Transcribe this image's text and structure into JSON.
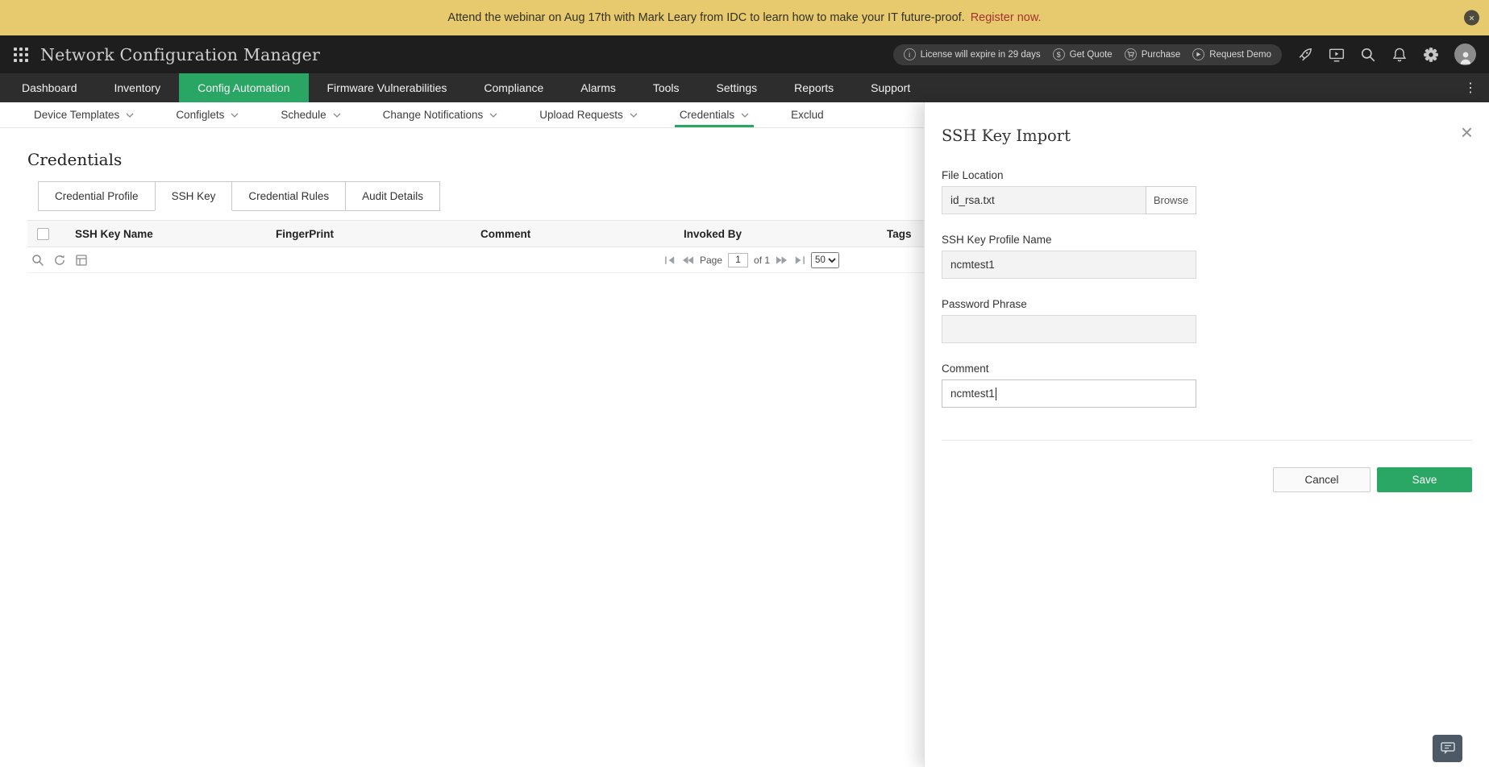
{
  "colors": {
    "accent_green": "#2aa664",
    "banner_bg": "#e8ca6e",
    "banner_link_red": "#a33432",
    "header_bg": "#1e1e1e",
    "nav_bg": "#2d2d2d",
    "save_button_green": "#2aa765"
  },
  "icons": {
    "close_glyph": "×",
    "overflow_glyph": "⋮",
    "info_glyph": "i",
    "dollar_glyph": "$"
  },
  "banner": {
    "text": "Attend the webinar on Aug 17th with Mark Leary from IDC to learn how to make your IT future-proof.",
    "link": "Register now."
  },
  "header": {
    "title": "Network Configuration Manager",
    "license_badge": "License will expire in 29 days",
    "quick_links": [
      {
        "label": "Get Quote"
      },
      {
        "label": "Purchase"
      },
      {
        "label": "Request Demo"
      }
    ]
  },
  "nav": {
    "active": "Config Automation",
    "items": [
      {
        "label": "Dashboard"
      },
      {
        "label": "Inventory"
      },
      {
        "label": "Config Automation"
      },
      {
        "label": "Firmware Vulnerabilities"
      },
      {
        "label": "Compliance"
      },
      {
        "label": "Alarms"
      },
      {
        "label": "Tools"
      },
      {
        "label": "Settings"
      },
      {
        "label": "Reports"
      },
      {
        "label": "Support"
      }
    ]
  },
  "subnav": {
    "active": "Credentials",
    "items": [
      {
        "label": "Device Templates"
      },
      {
        "label": "Configlets"
      },
      {
        "label": "Schedule"
      },
      {
        "label": "Change Notifications"
      },
      {
        "label": "Upload Requests"
      },
      {
        "label": "Credentials"
      },
      {
        "label": "Exclud"
      }
    ]
  },
  "content": {
    "heading": "Credentials",
    "active_tab": "SSH Key",
    "tabs": [
      {
        "label": "Credential Profile"
      },
      {
        "label": "SSH Key"
      },
      {
        "label": "Credential Rules"
      },
      {
        "label": "Audit Details"
      }
    ],
    "table": {
      "columns": [
        "SSH Key Name",
        "FingerPrint",
        "Comment",
        "Invoked By",
        "Tags"
      ],
      "rows": []
    },
    "pagination": {
      "page_label": "Page",
      "page_value": "1",
      "of_label": "of 1",
      "page_size": "50"
    }
  },
  "panel": {
    "title": "SSH Key Import",
    "file_location": {
      "label": "File Location",
      "value": "id_rsa.txt",
      "browse": "Browse"
    },
    "profile_name": {
      "label": "SSH Key Profile Name",
      "value": "ncmtest1"
    },
    "password_phrase": {
      "label": "Password Phrase",
      "value": ""
    },
    "comment": {
      "label": "Comment",
      "value": "ncmtest1"
    },
    "cancel": "Cancel",
    "save": "Save"
  }
}
